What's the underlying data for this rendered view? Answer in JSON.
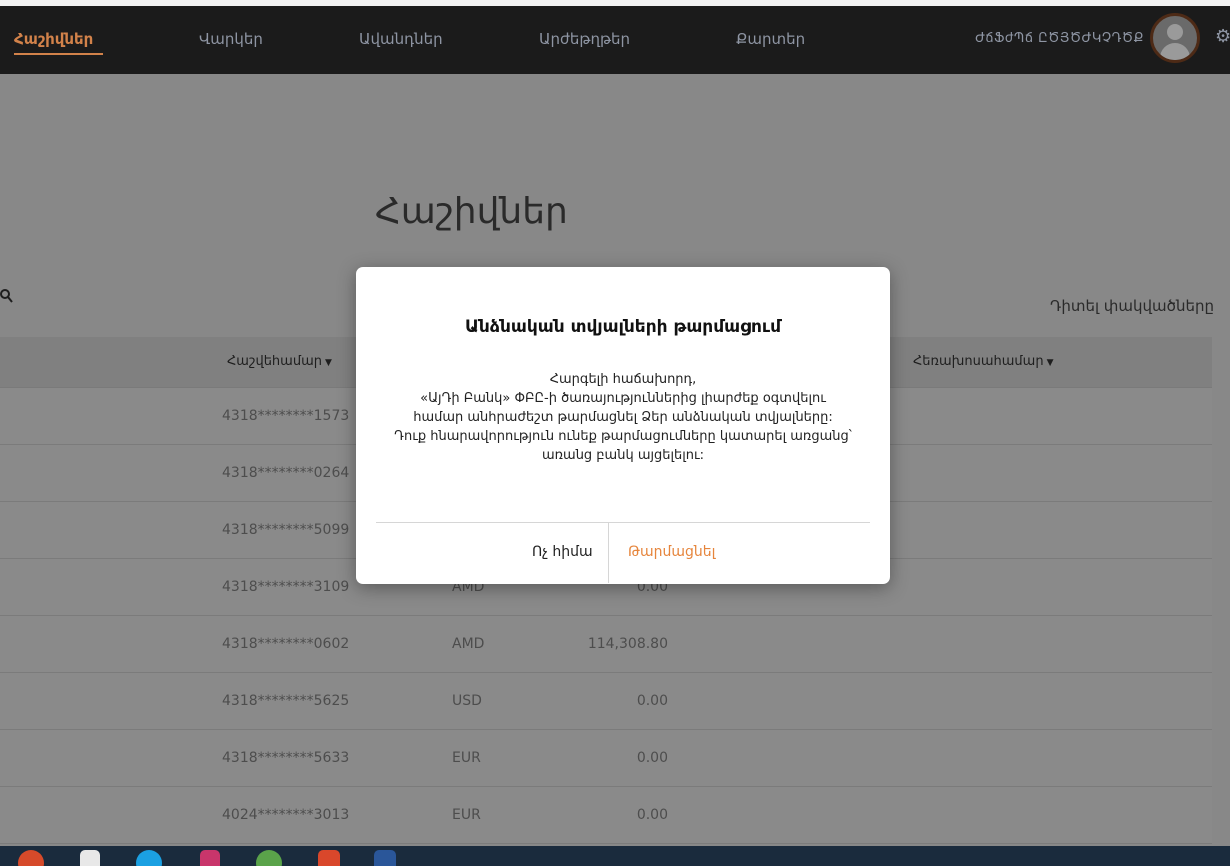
{
  "nav": {
    "items": [
      {
        "label": "Հաշիվներ"
      },
      {
        "label": "Վարկեր"
      },
      {
        "label": "Ավանդներ"
      },
      {
        "label": "Արժեթղթեր"
      },
      {
        "label": "Քարտեր"
      }
    ],
    "user_name": "ԺճՖժՊճ ԸԾՅԾԺԿՉԴԾՔ",
    "avatar_icon": "user-avatar-icon",
    "settings_icon": "gear-icon"
  },
  "page": {
    "title": "Հաշիվներ",
    "search_icon": "search-icon",
    "show_closed": "Դիտել փակվածները"
  },
  "table": {
    "headers": {
      "account_number": "Հաշվեհամար",
      "beneficiary": "Հեռախոսահամար"
    },
    "rows": [
      {
        "number": "4318********1573",
        "currency": "",
        "balance": ""
      },
      {
        "number": "4318********0264",
        "currency": "",
        "balance": ""
      },
      {
        "number": "4318********5099",
        "currency": "",
        "balance": ""
      },
      {
        "number": "4318********3109",
        "currency": "AMD",
        "balance": "0.00"
      },
      {
        "number": "4318********0602",
        "currency": "AMD",
        "balance": "114,308.80"
      },
      {
        "number": "4318********5625",
        "currency": "USD",
        "balance": "0.00"
      },
      {
        "number": "4318********5633",
        "currency": "EUR",
        "balance": "0.00"
      },
      {
        "number": "4024********3013",
        "currency": "EUR",
        "balance": "0.00"
      }
    ]
  },
  "modal": {
    "title": "Անձնական տվյալների թարմացում",
    "body_lines": [
      "Հարգելի հաճախորդ,",
      "«ԱյԴի Բանկ» ՓԲԸ-ի ծառայություններից լիարժեք օգտվելու",
      "համար անհրաժեշտ թարմացնել Ձեր անձնական տվյալները:",
      "Դուք հնարավորություն ունեք թարմացումները կատարել առցանց՝",
      "առանց բանկ այցելելու:"
    ],
    "later_label": "Ոչ հիմա",
    "update_label": "Թարմացնել"
  },
  "colors": {
    "accent": "#e6853c",
    "nav_bg": "#1b1b1b",
    "overlay_bg": "#888888"
  }
}
